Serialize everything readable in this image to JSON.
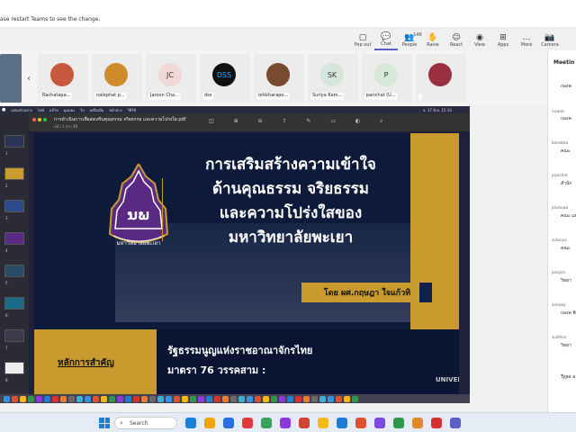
{
  "notice": "ase restart Teams to see the change.",
  "toolbar": [
    {
      "icon": "▢",
      "label": "Pop out",
      "name": "popout-button"
    },
    {
      "icon": "💬",
      "label": "Chat",
      "name": "chat-button",
      "active": true
    },
    {
      "icon": "👥",
      "label": "People",
      "name": "people-button",
      "badge": "146"
    },
    {
      "icon": "✋",
      "label": "Raise",
      "name": "raise-button"
    },
    {
      "icon": "☺",
      "label": "React",
      "name": "react-button"
    },
    {
      "icon": "◉",
      "label": "View",
      "name": "view-button"
    },
    {
      "icon": "⊞",
      "label": "Apps",
      "name": "apps-button"
    },
    {
      "icon": "…",
      "label": "More",
      "name": "more-button"
    },
    {
      "icon": "📷",
      "label": "Camera",
      "name": "camera-button"
    }
  ],
  "participants": [
    {
      "name": "Rachatapa...",
      "initials": "",
      "color": "#c8583d"
    },
    {
      "name": "nalephat p...",
      "initials": "",
      "color": "#d08a2a"
    },
    {
      "name": "Jaroon Cha...",
      "initials": "JC",
      "color": "#f0d8d6"
    },
    {
      "name": "dss",
      "initials": "DSS",
      "color": "#111"
    },
    {
      "name": "orkkharapo...",
      "initials": "",
      "color": "#7a4a30"
    },
    {
      "name": "Suriya Kam...",
      "initials": "SK",
      "color": "#d6e6dc"
    },
    {
      "name": "parichat (U...",
      "initials": "P",
      "color": "#d7ead9"
    },
    {
      "name": "",
      "initials": "",
      "color": "#9a2f40"
    }
  ],
  "meeting_panel": {
    "title": "Meetin",
    "chats": [
      {
        "sender": "",
        "text": "กองค"
      },
      {
        "sender": "กองคลัง",
        "text": "กองค"
      },
      {
        "sender": "banolkka",
        "text": "คณะ"
      },
      {
        "sender": "piyachat",
        "text": "สำนัก"
      },
      {
        "sender": "phanuwa",
        "text": "คณะ แผ่น"
      },
      {
        "sender": "sukunya",
        "text": "คณะ"
      },
      {
        "sender": "penpim",
        "text": "วิทยา"
      },
      {
        "sender": "annowy",
        "text": "กองค พิการ"
      },
      {
        "sender": "sunthon",
        "text": "วิทยา"
      },
      {
        "sender": "",
        "text": "Type a"
      }
    ]
  },
  "mac_menu": [
    "แสดงตัวอย่าง",
    "ไฟล์",
    "แก้ไข",
    "มุมมอง",
    "ไป",
    "เครื่องมือ",
    "หน้าต่าง",
    "วิธีใช้"
  ],
  "mac_time": "จ. 17 มี.ค. 15:14",
  "pdf": {
    "filename": "การดำเนินการเพื่อส่งเสริมคุณธรรม จริยธรรม และความโปร่งใส.pdf",
    "pages": "หน้า 1 จาก 48"
  },
  "thumbnail_pages": [
    "1",
    "2",
    "3",
    "4",
    "5",
    "6",
    "7",
    "8"
  ],
  "slide": {
    "title_lines": [
      "การเสริมสร้างความเข้าใจ",
      "ด้านคุณธรรม จริยธรรม",
      "และความโปร่งใสของ",
      "มหาวิทยาลัยพะเยา"
    ],
    "author": "โดย ผศ.กฤษฎา ใจแก้วทิ",
    "principle": "หลักการสำคัญ",
    "law_line1": "รัฐธรรมนูญแห่งราชอาณาจักรไทย",
    "law_line2": "มาตรา 76 วรรคสาม :",
    "university_mark": "UNIVERSITY",
    "logo_text": "มหาวิทยาลัยพะเยา",
    "logo_letters": "ນພ",
    "colors": {
      "gold": "#c99a2e",
      "navy": "#0d1a3a",
      "purple": "#5a2a82"
    }
  },
  "taskbar": {
    "search_placeholder": "Search",
    "apps": [
      "#1b7fd8",
      "#f0a500",
      "#2b6fe0",
      "#e03a3a",
      "#3aa05a",
      "#8a3ad8",
      "#d0452e",
      "#f2b91e",
      "#1f7bd8",
      "#e0522e",
      "#7a4ae0",
      "#2a9a4a",
      "#e08a2a",
      "#d83030",
      "#5b5fc7"
    ]
  }
}
